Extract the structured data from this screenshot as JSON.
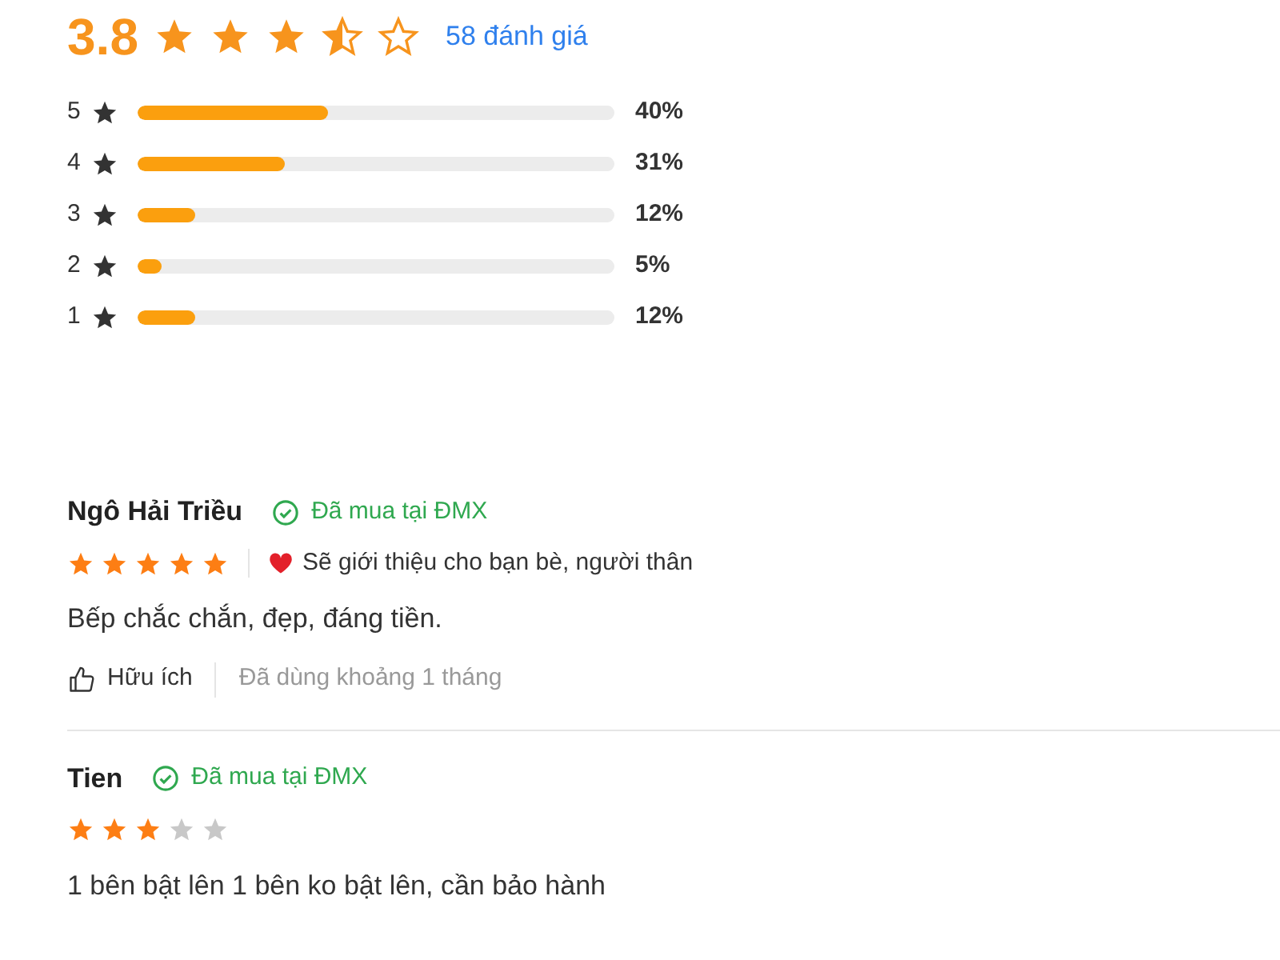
{
  "summary": {
    "score": "3.8",
    "stars": 3.5,
    "count": "58 đánh giá"
  },
  "breakdown": [
    {
      "label": "5",
      "level": 0.4,
      "percent": "40%"
    },
    {
      "label": "4",
      "level": 0.31,
      "percent": "31%"
    },
    {
      "label": "3",
      "level": 0.12,
      "percent": "12%"
    },
    {
      "label": "2",
      "level": 0.05,
      "percent": "5%"
    },
    {
      "label": "1",
      "level": 0.12,
      "percent": "12%"
    }
  ],
  "reviews": [
    {
      "name": "Ngô Hải Triều",
      "badge": "Đã mua tại ĐMX",
      "stars": 5,
      "recommend": "Sẽ giới thiệu cho bạn bè, người thân",
      "text": "Bếp chắc chắn, đẹp, đáng tiền.",
      "helpful": "Hữu ích",
      "usage": "Đã dùng khoảng 1 tháng"
    },
    {
      "name": "Tien",
      "badge": "Đã mua tại ĐMX",
      "stars": 3,
      "text": "1 bên bật lên 1 bên ko bật lên, cần bảo hành"
    }
  ]
}
